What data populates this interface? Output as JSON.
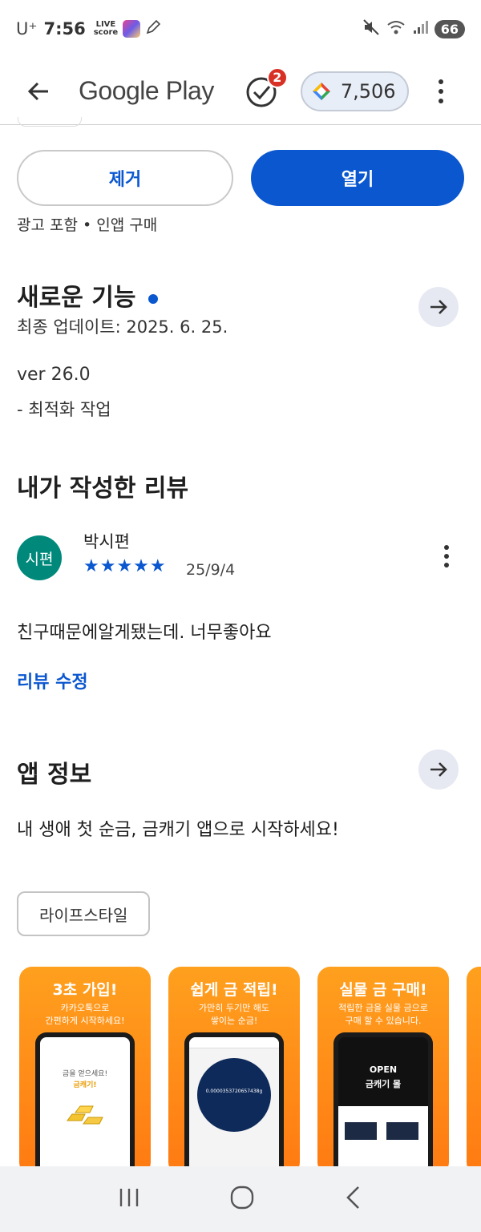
{
  "status_bar": {
    "carrier": "U⁺",
    "time": "7:56",
    "live_score_top": "LIVE",
    "live_score_bottom": "score",
    "battery": "66"
  },
  "app_bar": {
    "title": "Google Play",
    "notification_count": "2",
    "points": "7,506"
  },
  "actions": {
    "uninstall_label": "제거",
    "open_label": "열기",
    "ad_note": "광고 포함 • 인앱 구매"
  },
  "whats_new": {
    "title": "새로운 기능",
    "updated": "최종 업데이트: 2025. 6. 25.",
    "version": "ver 26.0",
    "note": "- 최적화 작업"
  },
  "my_review": {
    "title": "내가 작성한 리뷰",
    "avatar_text": "시편",
    "reviewer": "박시편",
    "stars": "★★★★★",
    "date": "25/9/4",
    "body": "친구때문에알게됐는데. 너무좋아요",
    "edit_link": "리뷰 수정"
  },
  "app_info": {
    "title": "앱 정보",
    "description": "내 생애 첫 순금, 금캐기 앱으로 시작하세요!",
    "category": "라이프스타일"
  },
  "screenshots": [
    {
      "title": "3초 가입!",
      "sub1": "카카오톡으로",
      "sub2": "간편하게 시작하세요!",
      "screen_line1": "금을 얻으세요!",
      "screen_line2": "금캐기!"
    },
    {
      "title": "쉽게 금 적립!",
      "sub1": "가만히 두기만 해도",
      "sub2": "쌓이는 순금!",
      "screen_value": "0.0000353720657438g"
    },
    {
      "title": "실물 금 구매!",
      "sub1": "적립한 금을 실물 금으로",
      "sub2": "구매 할 수 있습니다.",
      "screen_line1": "OPEN",
      "screen_line2": "금캐기 몰"
    }
  ]
}
